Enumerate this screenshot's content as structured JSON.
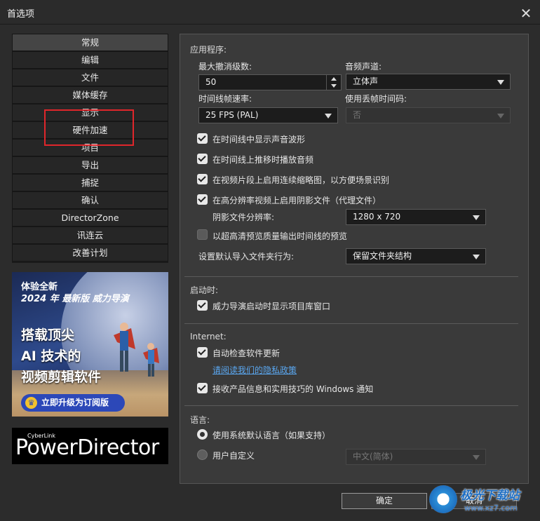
{
  "window": {
    "title": "首选项",
    "close_symbol": "✕"
  },
  "sidebar": {
    "items": [
      {
        "label": "常规",
        "active": true
      },
      {
        "label": "编辑"
      },
      {
        "label": "文件"
      },
      {
        "label": "媒体缓存"
      },
      {
        "label": "显示"
      },
      {
        "label": "硬件加速"
      },
      {
        "label": "项目"
      },
      {
        "label": "导出"
      },
      {
        "label": "捕捉"
      },
      {
        "label": "确认"
      },
      {
        "label": "DirectorZone"
      },
      {
        "label": "讯连云"
      },
      {
        "label": "改善计划"
      }
    ]
  },
  "ad": {
    "line1": "体验全新",
    "line2": "2024 年 最新版 威力导演",
    "big1": "搭载顶尖",
    "big2": "AI 技术的",
    "big3": "视频剪辑软件",
    "button": "立即升级为订阅版"
  },
  "logo": {
    "small": "CyberLink",
    "big": "PowerDirector"
  },
  "app_section": {
    "heading": "应用程序:",
    "max_undo_label": "最大撤消级数:",
    "max_undo_value": "50",
    "audio_channel_label": "音频声道:",
    "audio_channel_value": "立体声",
    "timeline_fps_label": "时间线帧速率:",
    "timeline_fps_value": "25 FPS (PAL)",
    "drop_frame_label": "使用丢帧时间码:",
    "drop_frame_value": "否",
    "opt_waveform": "在时间线中显示声音波形",
    "opt_scrub_audio": "在时间线上推移时播放音频",
    "opt_thumbnails": "在视频片段上启用连续缩略图，以方便场景识别",
    "opt_shadow_files": "在高分辨率视频上启用阴影文件（代理文件）",
    "shadow_res_label": "阴影文件分辨率:",
    "shadow_res_value": "1280 x 720",
    "opt_hq_preview": "以超高清预览质量输出时间线的预览",
    "import_behavior_label": "设置默认导入文件夹行为:",
    "import_behavior_value": "保留文件夹结构"
  },
  "startup_section": {
    "heading": "启动时:",
    "opt_show_library": "威力导演启动时显示项目库窗口"
  },
  "internet_section": {
    "heading": "Internet:",
    "opt_auto_update": "自动检查软件更新",
    "privacy_link": "请阅读我们的隐私政策",
    "opt_notifications": "接收产品信息和实用技巧的 Windows 通知"
  },
  "language_section": {
    "heading": "语言:",
    "opt_system": "使用系统默认语言（如果支持）",
    "opt_custom": "用户自定义",
    "custom_value": "中文(简体)"
  },
  "footer": {
    "ok": "确定",
    "cancel": "取消"
  },
  "watermark": {
    "text": "极光下载站",
    "url": "www.xz7.com"
  },
  "colors": {
    "highlight_box": "#e0262b",
    "link": "#5aa7f0",
    "ad_button": "#2c48b8"
  }
}
